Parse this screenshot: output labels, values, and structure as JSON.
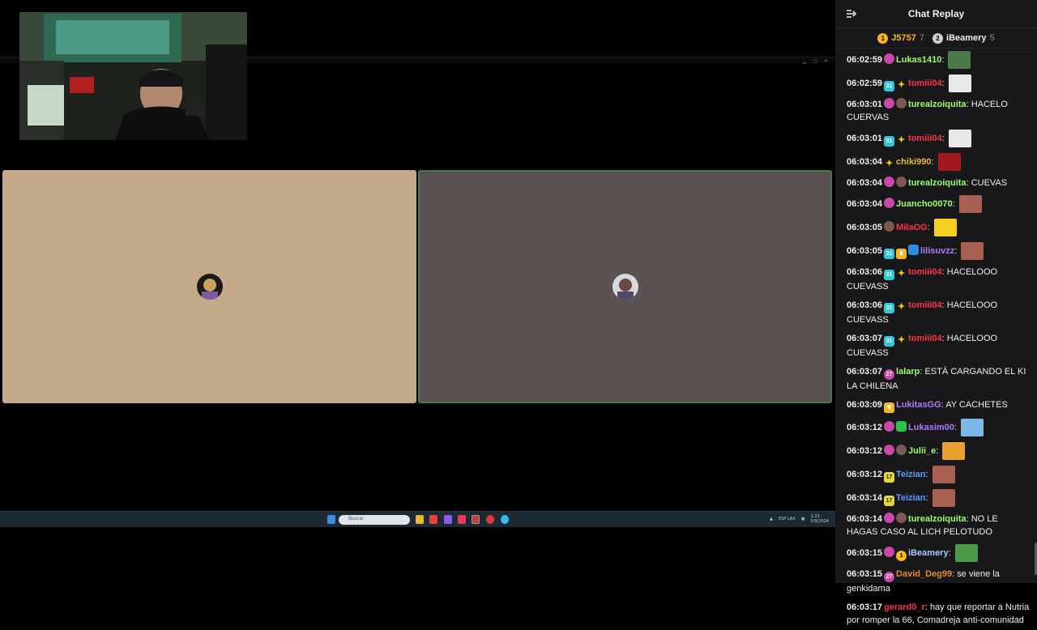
{
  "chat": {
    "title": "Chat Replay",
    "leaderboard": [
      {
        "rank": "1",
        "name": "J5757",
        "count": "7",
        "color": "#f5b820",
        "name_color": "#f5b820"
      },
      {
        "rank": "2",
        "name": "iBeamery",
        "count": "5",
        "color": "#d0d0d0",
        "name_color": "#efeff1"
      }
    ],
    "messages": [
      {
        "time": "06:02:59",
        "badges": [
          "b-sub"
        ],
        "user": "Lukas1410",
        "color": "#9aff6a",
        "text": "",
        "emote": "#4a7a4a"
      },
      {
        "time": "06:02:59",
        "badges": [
          "b-sub31",
          "b-hype"
        ],
        "user": "tomiii04",
        "color": "#ff3347",
        "text": "",
        "emote": "#e8e8e8"
      },
      {
        "time": "06:03:01",
        "badges": [
          "b-sub",
          "b-face"
        ],
        "user": "turealzoiquita",
        "color": "#9aff6a",
        "text": "HACELO CUERVAS",
        "emote": ""
      },
      {
        "time": "06:03:01",
        "badges": [
          "b-sub31",
          "b-hype"
        ],
        "user": "tomiii04",
        "color": "#ff3347",
        "text": "",
        "emote": "#e8e8e8"
      },
      {
        "time": "06:03:04",
        "badges": [
          "b-hype"
        ],
        "user": "chiki990",
        "color": "#e6b83a",
        "text": "",
        "emote": "#a01820"
      },
      {
        "time": "06:03:04",
        "badges": [
          "b-sub",
          "b-face"
        ],
        "user": "turealzoiquita",
        "color": "#9aff6a",
        "text": "CUEVAS",
        "emote": ""
      },
      {
        "time": "06:03:04",
        "badges": [
          "b-sub"
        ],
        "user": "Juancho0070",
        "color": "#9aff6a",
        "text": "",
        "emote": "#a86050"
      },
      {
        "time": "06:03:05",
        "badges": [
          "b-face"
        ],
        "user": "MilaOG",
        "color": "#ff3347",
        "text": "",
        "emote": "#f5d020"
      },
      {
        "time": "06:03:05",
        "badges": [
          "b-sub31",
          "b-crown",
          "b-blue"
        ],
        "user": "lilisuvzz",
        "color": "#b07aff",
        "text": "",
        "emote": "#a86050"
      },
      {
        "time": "06:03:06",
        "badges": [
          "b-sub31",
          "b-hype"
        ],
        "user": "tomiii04",
        "color": "#ff3347",
        "text": "HACELOOO CUEVASS",
        "emote": ""
      },
      {
        "time": "06:03:06",
        "badges": [
          "b-sub31",
          "b-hype"
        ],
        "user": "tomiii04",
        "color": "#ff3347",
        "text": "HACELOOO CUEVASS",
        "emote": ""
      },
      {
        "time": "06:03:07",
        "badges": [
          "b-sub31",
          "b-hype"
        ],
        "user": "tomiii04",
        "color": "#ff3347",
        "text": "HACELOOO CUEVASS",
        "emote": ""
      },
      {
        "time": "06:03:07",
        "badges": [
          "b-sub27"
        ],
        "user": "lalarp",
        "color": "#9aff6a",
        "text": "ESTÁ CARGANDO EL KI LA CHILENA",
        "emote": ""
      },
      {
        "time": "06:03:09",
        "badges": [
          "b-crown"
        ],
        "user": "LukitasGG",
        "color": "#b07aff",
        "text": "AY CACHETES",
        "emote": ""
      },
      {
        "time": "06:03:12",
        "badges": [
          "b-sub",
          "b-green"
        ],
        "user": "Lukasim00",
        "color": "#b07aff",
        "text": "",
        "emote": "#7ab8e8"
      },
      {
        "time": "06:03:12",
        "badges": [
          "b-sub",
          "b-face"
        ],
        "user": "Julii_e",
        "color": "#9aff6a",
        "text": "",
        "emote": "#e8a030"
      },
      {
        "time": "06:03:12",
        "badges": [
          "b-sub17"
        ],
        "user": "Teizian",
        "color": "#5a9cff",
        "text": "",
        "emote": "#a86050"
      },
      {
        "time": "06:03:14",
        "badges": [
          "b-sub17"
        ],
        "user": "Teizian",
        "color": "#5a9cff",
        "text": "",
        "emote": "#a86050"
      },
      {
        "time": "06:03:14",
        "badges": [
          "b-sub",
          "b-face"
        ],
        "user": "turealzoiquita",
        "color": "#9aff6a",
        "text": "NO LE HAGAS CASO AL LICH PELOTUDO",
        "emote": ""
      },
      {
        "time": "06:03:15",
        "badges": [
          "b-sub",
          "b-gold"
        ],
        "user": "iBeamery",
        "color": "#a8c8ff",
        "text": "",
        "emote": "#4a9a4a"
      },
      {
        "time": "06:03:15",
        "badges": [
          "b-sub27"
        ],
        "user": "David_Deg99",
        "color": "#e6883a",
        "text": "se viene la genkidama",
        "emote": ""
      },
      {
        "time": "06:03:17",
        "badges": [],
        "user": "gerard0_r",
        "color": "#ff3347",
        "text": "hay que reportar a Nutria por romper la 66, Comadreja anti-comunidad",
        "emote": ""
      }
    ]
  },
  "stream": {
    "taskbar": {
      "search_placeholder": "Buscar",
      "tray_lang": "ESP LAA",
      "clock_time": "1:23",
      "clock_date": "5/9/2024"
    },
    "colors": {
      "left_tile": "#c5a98b",
      "right_tile": "#595250"
    }
  }
}
